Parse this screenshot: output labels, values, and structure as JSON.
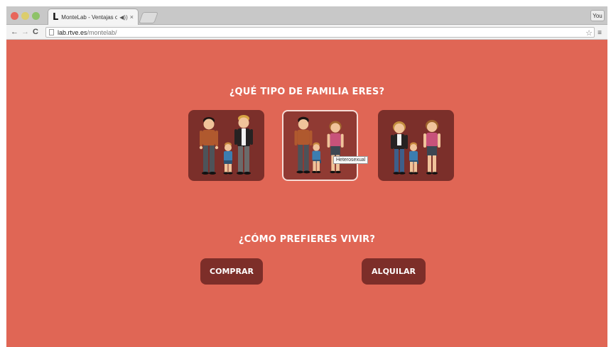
{
  "browser": {
    "tab_title": "MonteLab - Ventajas o",
    "tab_favicon": "L",
    "tab_audio": "◀))",
    "tab_close": "×",
    "profile_label": "You",
    "nav": {
      "back": "←",
      "forward": "→",
      "reload": "C"
    },
    "url_domain": "lab.rtve.es",
    "url_path": "/montelab/",
    "bookmark_icon": "☆",
    "menu_icon": "≡"
  },
  "page": {
    "question_family": "¿QUÉ TIPO DE FAMILIA ERES?",
    "question_living": "¿CÓMO PREFIERES VIVIR?",
    "family_options": [
      {
        "id": "homosexual-men",
        "icon": "two-fathers-child-icon"
      },
      {
        "id": "heterosexual",
        "icon": "father-mother-child-icon",
        "selected": true
      },
      {
        "id": "homosexual-women",
        "icon": "two-mothers-child-icon"
      }
    ],
    "tooltip": "Heterosexual",
    "buttons": {
      "buy": "COMPRAR",
      "rent": "ALQUILAR"
    }
  },
  "colors": {
    "page_background": "#e06655",
    "card_background": "#7b2f2a",
    "button_background": "#7d2e29",
    "heading_text": "#ffffff"
  }
}
